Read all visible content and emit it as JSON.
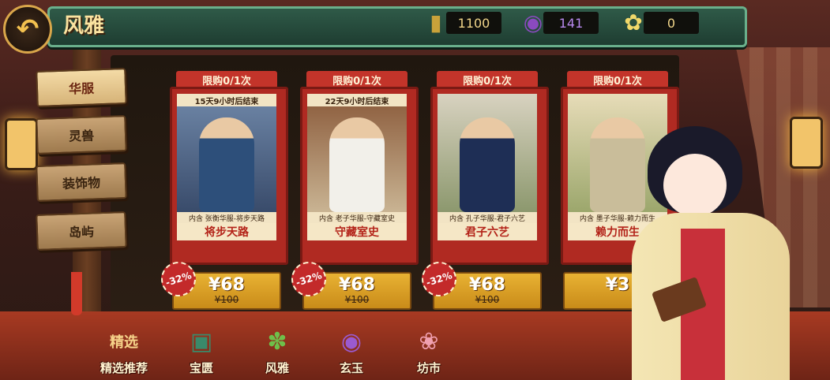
{
  "header": {
    "title": "风雅"
  },
  "resources": [
    {
      "icon": "jade-token-icon",
      "value": "1100"
    },
    {
      "icon": "purple-swirl-icon",
      "value": "141"
    },
    {
      "icon": "flower-icon",
      "value": "0"
    }
  ],
  "sidebar": {
    "items": [
      {
        "label": "华服",
        "active": true
      },
      {
        "label": "灵兽",
        "active": false
      },
      {
        "label": "装饰物",
        "active": false
      },
      {
        "label": "岛屿",
        "active": false
      }
    ]
  },
  "cards": [
    {
      "limit": "限购0/1次",
      "timer": "15天9小时后结束",
      "contents": "内含 张衡华服-将步天路",
      "name": "将步天路",
      "discount": "-32%",
      "price": "¥68",
      "old_price": "¥100"
    },
    {
      "limit": "限购0/1次",
      "timer": "22天9小时后结束",
      "contents": "内含 老子华服-守藏室史",
      "name": "守藏室史",
      "discount": "-32%",
      "price": "¥68",
      "old_price": "¥100"
    },
    {
      "limit": "限购0/1次",
      "timer": "",
      "contents": "内含 孔子华服-君子六艺",
      "name": "君子六艺",
      "discount": "-32%",
      "price": "¥68",
      "old_price": "¥100"
    },
    {
      "limit": "限购0/1次",
      "timer": "",
      "contents": "内含 墨子华服-赖力而生",
      "name": "赖力而生",
      "discount": "",
      "price": "¥3",
      "old_price": ""
    }
  ],
  "bottom_nav": [
    {
      "label": "精选推荐",
      "badge": "精选"
    },
    {
      "label": "宝匮"
    },
    {
      "label": "风雅"
    },
    {
      "label": "玄玉"
    },
    {
      "label": "坊市"
    }
  ]
}
